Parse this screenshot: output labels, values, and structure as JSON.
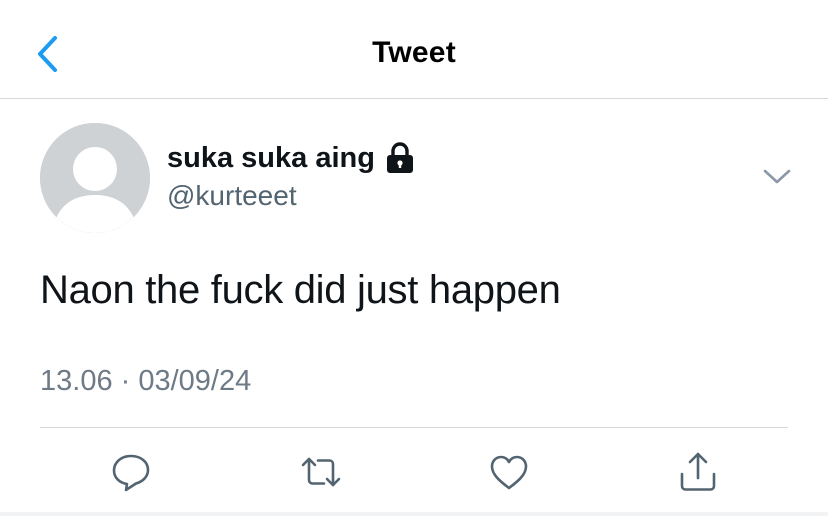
{
  "header": {
    "title": "Tweet",
    "back_icon": "chevron-left-icon",
    "accent_color": "#1d9bf0"
  },
  "tweet": {
    "display_name": "suka suka aing",
    "protected_icon": "lock-icon",
    "handle": "@kurteeet",
    "text": "Naon the fuck did just happen",
    "timestamp": "13.06 · 03/09/24",
    "avatar_icon": "default-avatar-icon",
    "more_icon": "chevron-down-icon"
  },
  "actions": [
    {
      "name": "reply",
      "icon": "reply-icon"
    },
    {
      "name": "retweet",
      "icon": "retweet-icon"
    },
    {
      "name": "like",
      "icon": "heart-icon"
    },
    {
      "name": "share",
      "icon": "share-icon"
    }
  ],
  "colors": {
    "text_primary": "#0f1419",
    "text_secondary": "#536471",
    "divider": "#d6d9dc",
    "icon_gray": "#536471"
  }
}
